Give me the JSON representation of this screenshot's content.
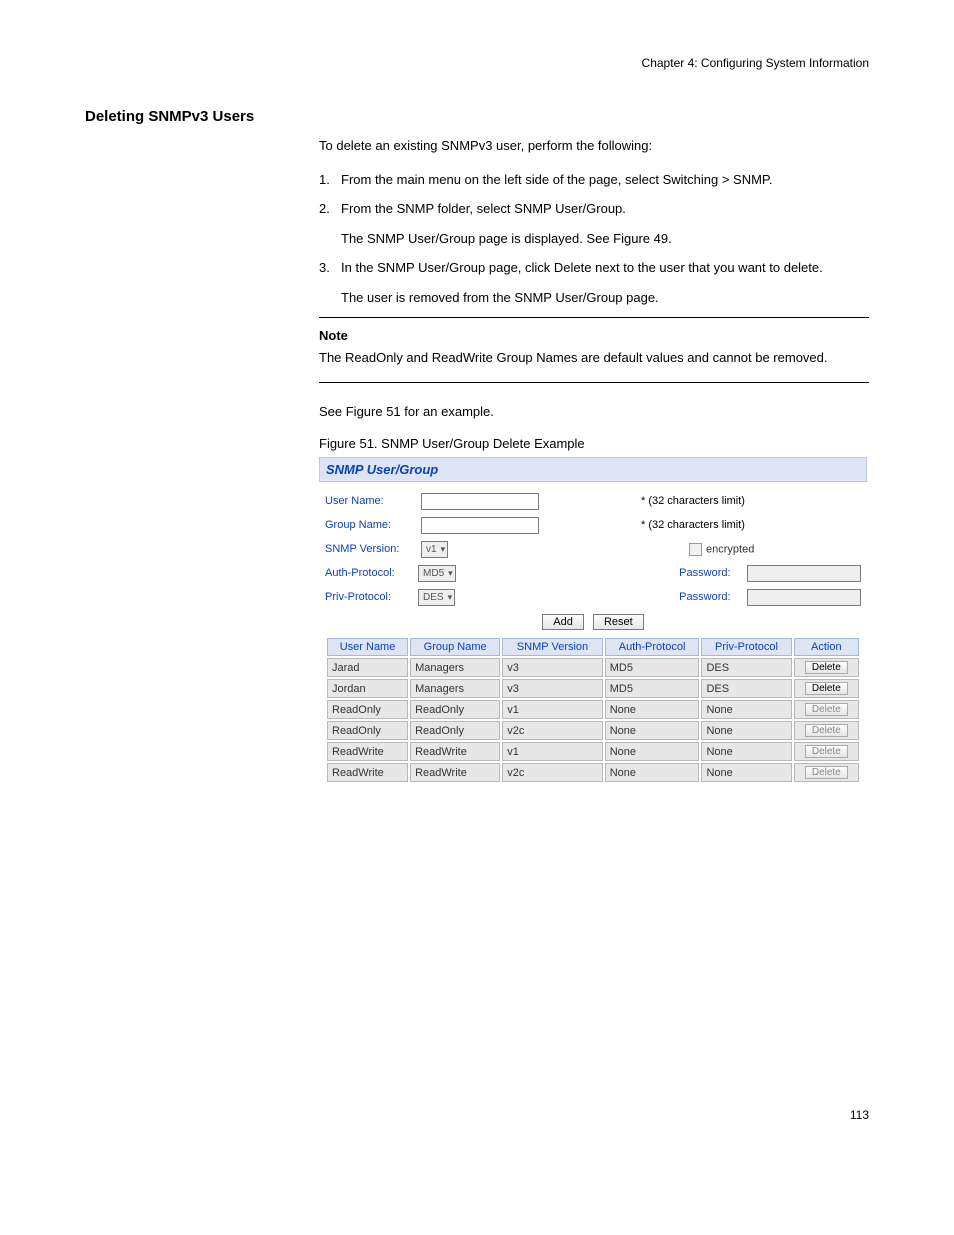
{
  "header": {
    "chapter_line": "Chapter 4: Configuring System Information"
  },
  "section": {
    "title": "Deleting SNMPv3 Users",
    "intro": "To delete an existing SNMPv3 user, perform the following:",
    "steps": [
      "From the main menu on the left side of the page, select Switching > SNMP.",
      "From the SNMP folder, select SNMP User/Group.",
      "The SNMP User/Group page is displayed. See Figure 49.",
      "In the SNMP User/Group page, click Delete next to the user that you want to delete."
    ],
    "post_step": "The user is removed from the SNMP User/Group page.",
    "note": {
      "title": "Note",
      "body": "The ReadOnly and ReadWrite Group Names are default values and cannot be removed."
    },
    "closing": "See Figure 51 for an example.",
    "figure_caption": "Figure 51. SNMP User/Group Delete Example"
  },
  "panel": {
    "title": "SNMP User/Group",
    "form": {
      "user_name_label": "User Name:",
      "group_name_label": "Group Name:",
      "snmp_version_label": "SNMP Version:",
      "auth_protocol_label": "Auth-Protocol:",
      "priv_protocol_label": "Priv-Protocol:",
      "hint_user": "* (32 characters limit)",
      "hint_group": "* (32 characters limit)",
      "snmp_version_value": "v1",
      "auth_protocol_value": "MD5",
      "priv_protocol_value": "DES",
      "encrypted_label": "encrypted",
      "password_label_auth": "Password:",
      "password_label_priv": "Password:",
      "add_label": "Add",
      "reset_label": "Reset"
    },
    "table": {
      "headers": {
        "user_name": "User Name",
        "group_name": "Group Name",
        "snmp_version": "SNMP Version",
        "auth_protocol": "Auth-Protocol",
        "priv_protocol": "Priv-Protocol",
        "action": "Action"
      },
      "delete_label": "Delete",
      "rows": [
        {
          "user": "Jarad",
          "group": "Managers",
          "ver": "v3",
          "auth": "MD5",
          "priv": "DES",
          "deletable": true
        },
        {
          "user": "Jordan",
          "group": "Managers",
          "ver": "v3",
          "auth": "MD5",
          "priv": "DES",
          "deletable": true
        },
        {
          "user": "ReadOnly",
          "group": "ReadOnly",
          "ver": "v1",
          "auth": "None",
          "priv": "None",
          "deletable": false
        },
        {
          "user": "ReadOnly",
          "group": "ReadOnly",
          "ver": "v2c",
          "auth": "None",
          "priv": "None",
          "deletable": false
        },
        {
          "user": "ReadWrite",
          "group": "ReadWrite",
          "ver": "v1",
          "auth": "None",
          "priv": "None",
          "deletable": false
        },
        {
          "user": "ReadWrite",
          "group": "ReadWrite",
          "ver": "v2c",
          "auth": "None",
          "priv": "None",
          "deletable": false
        }
      ]
    }
  },
  "footer": {
    "page_number": "113"
  }
}
